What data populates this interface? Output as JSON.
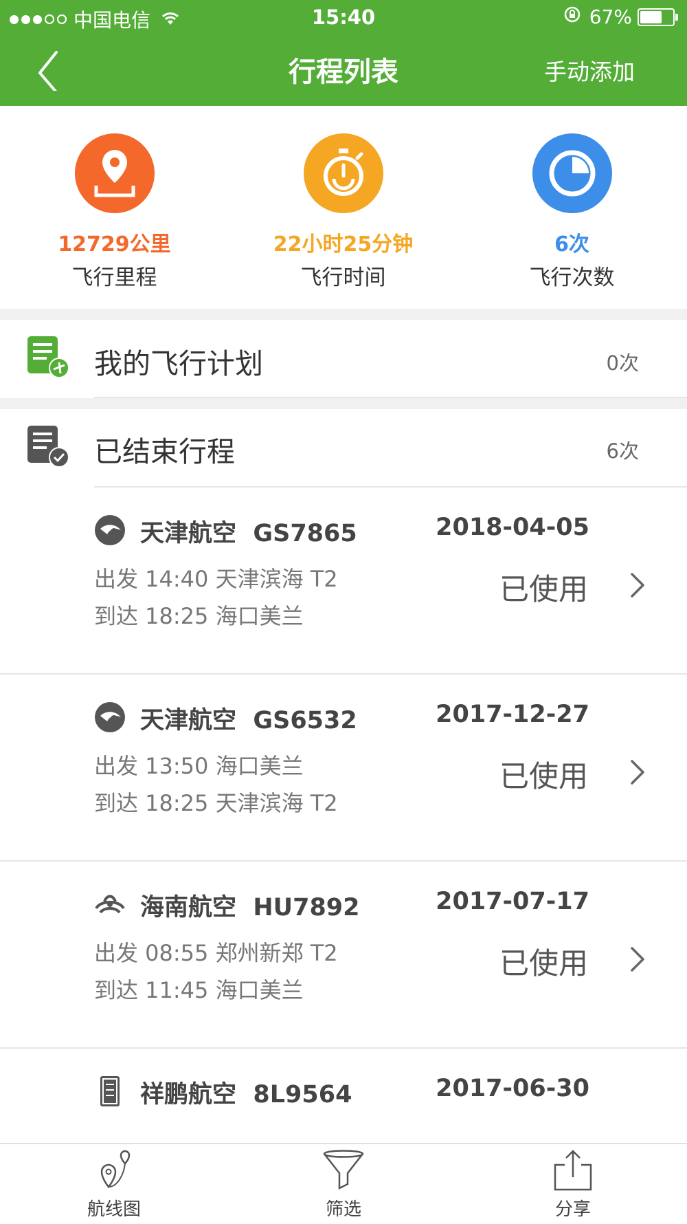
{
  "status_bar": {
    "carrier": "中国电信",
    "time": "15:40",
    "battery": "67%",
    "battery_level": 0.67
  },
  "nav": {
    "title": "行程列表",
    "action": "手动添加"
  },
  "stats": [
    {
      "value": "12729公里",
      "label": "飞行里程",
      "color": "#f4682c"
    },
    {
      "value": "22小时25分钟",
      "label": "飞行时间",
      "color": "#f5a623"
    },
    {
      "value": "6次",
      "label": "飞行次数",
      "color": "#3c8ee8"
    }
  ],
  "plan_section": {
    "title": "我的飞行计划",
    "count": "0次"
  },
  "finished_section": {
    "title": "已结束行程",
    "count": "6次"
  },
  "trips": [
    {
      "airline": "天津航空",
      "flight": "GS7865",
      "date": "2018-04-05",
      "dep": "出发 14:40  天津滨海  T2",
      "arr": "到达 18:25  海口美兰",
      "status": "已使用"
    },
    {
      "airline": "天津航空",
      "flight": "GS6532",
      "date": "2017-12-27",
      "dep": "出发 13:50  海口美兰",
      "arr": "到达 18:25  天津滨海  T2",
      "status": "已使用"
    },
    {
      "airline": "海南航空",
      "flight": "HU7892",
      "date": "2017-07-17",
      "dep": "出发 08:55  郑州新郑  T2",
      "arr": "到达 11:45  海口美兰",
      "status": "已使用"
    },
    {
      "airline": "祥鹏航空",
      "flight": "8L9564",
      "date": "2017-06-30",
      "dep": "",
      "arr": "",
      "status": ""
    }
  ],
  "tabs": [
    {
      "label": "航线图"
    },
    {
      "label": "筛选"
    },
    {
      "label": "分享"
    }
  ]
}
